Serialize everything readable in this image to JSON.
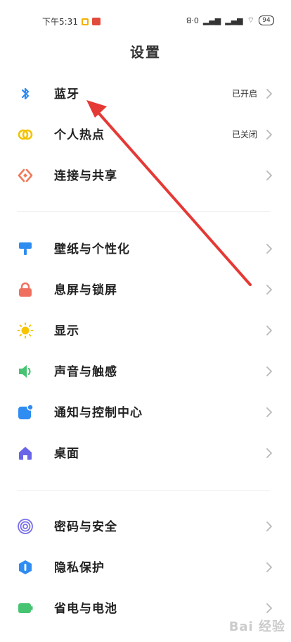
{
  "status_bar": {
    "time": "下午5:31",
    "right_text": "ꓭ·0",
    "battery": "94"
  },
  "header": {
    "title": "设置"
  },
  "settings": {
    "group1": [
      {
        "label": "蓝牙",
        "status": "已开启",
        "icon": "bluetooth-icon",
        "color": "#2f8cf0"
      },
      {
        "label": "个人热点",
        "status": "已关闭",
        "icon": "hotspot-icon",
        "color": "#f2c300"
      },
      {
        "label": "连接与共享",
        "status": "",
        "icon": "share-icon",
        "color": "#f07a5a"
      }
    ],
    "group2": [
      {
        "label": "壁纸与个性化",
        "icon": "paint-roller-icon",
        "color": "#2f8cf0"
      },
      {
        "label": "息屏与锁屏",
        "icon": "lock-icon",
        "color": "#f07060"
      },
      {
        "label": "显示",
        "icon": "sun-icon",
        "color": "#f7c500"
      },
      {
        "label": "声音与触感",
        "icon": "speaker-icon",
        "color": "#46c472"
      },
      {
        "label": "通知与控制中心",
        "icon": "notification-icon",
        "color": "#2f8cf0"
      },
      {
        "label": "桌面",
        "icon": "home-icon",
        "color": "#6a64e8"
      }
    ],
    "group3": [
      {
        "label": "密码与安全",
        "icon": "fingerprint-icon",
        "color": "#7a70e8"
      },
      {
        "label": "隐私保护",
        "icon": "privacy-icon",
        "color": "#2f8cf0"
      },
      {
        "label": "省电与电池",
        "icon": "battery-icon",
        "color": "#46c472"
      }
    ]
  },
  "annotation": {
    "color": "#e53935"
  },
  "watermark": {
    "text": "Bai 经验"
  }
}
